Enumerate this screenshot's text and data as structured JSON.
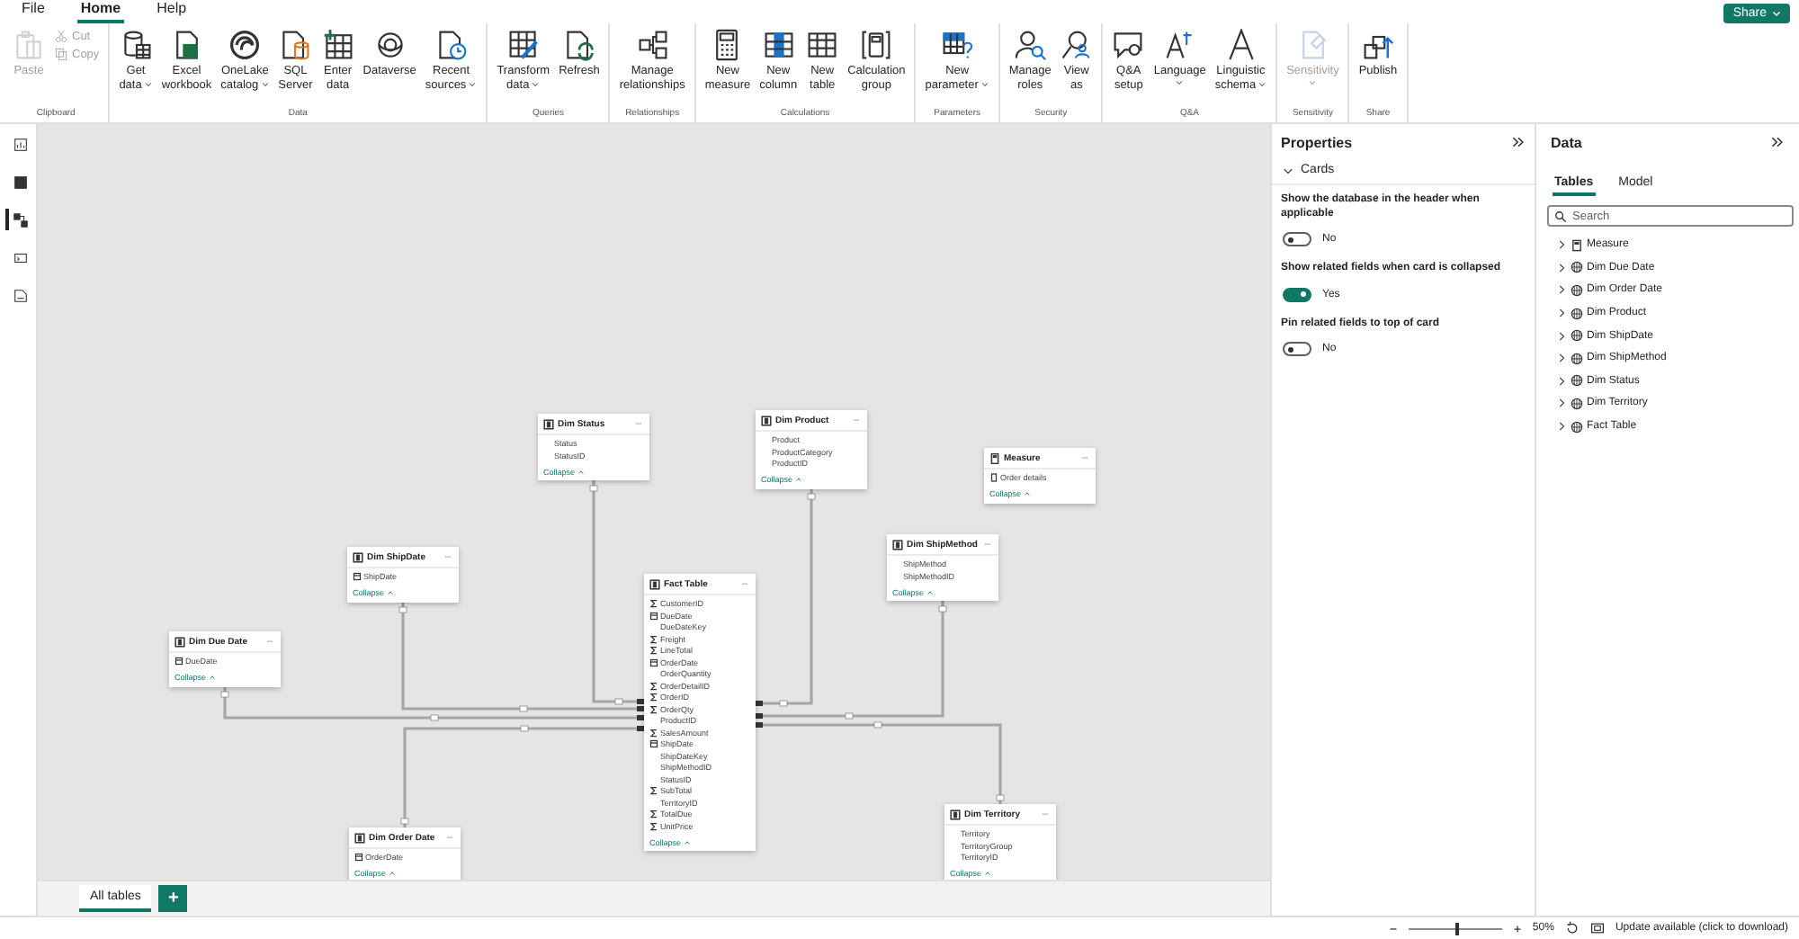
{
  "menu_tabs": [
    {
      "label": "File",
      "selected": false
    },
    {
      "label": "Home",
      "selected": true
    },
    {
      "label": "Help",
      "selected": false
    }
  ],
  "share_button": {
    "label": "Share"
  },
  "ribbon": [
    {
      "label": "Clipboard",
      "buttons": [
        {
          "kind": "large",
          "lines": [
            "Paste"
          ],
          "disabled": true,
          "dropdown": false
        },
        {
          "kind": "small",
          "lines": [
            "Cut"
          ],
          "disabled": true,
          "dropdown": false
        },
        {
          "kind": "small",
          "lines": [
            "Copy"
          ],
          "disabled": true,
          "dropdown": false
        }
      ]
    },
    {
      "label": "Data",
      "buttons": [
        {
          "kind": "large",
          "lines": [
            "Get",
            "data"
          ],
          "disabled": false,
          "dropdown": true
        },
        {
          "kind": "large",
          "lines": [
            "Excel",
            "workbook"
          ],
          "disabled": false,
          "dropdown": false
        },
        {
          "kind": "large",
          "lines": [
            "OneLake",
            "catalog"
          ],
          "disabled": false,
          "dropdown": true
        },
        {
          "kind": "large",
          "lines": [
            "SQL",
            "Server"
          ],
          "disabled": false,
          "dropdown": false
        },
        {
          "kind": "large",
          "lines": [
            "Enter",
            "data"
          ],
          "disabled": false,
          "dropdown": false
        },
        {
          "kind": "large",
          "lines": [
            "Dataverse"
          ],
          "disabled": false,
          "dropdown": false
        },
        {
          "kind": "large",
          "lines": [
            "Recent",
            "sources"
          ],
          "disabled": false,
          "dropdown": true
        }
      ]
    },
    {
      "label": "Queries",
      "buttons": [
        {
          "kind": "large",
          "lines": [
            "Transform",
            "data"
          ],
          "disabled": false,
          "dropdown": true
        },
        {
          "kind": "large",
          "lines": [
            "Refresh"
          ],
          "disabled": false,
          "dropdown": false
        }
      ]
    },
    {
      "label": "Relationships",
      "buttons": [
        {
          "kind": "large",
          "lines": [
            "Manage",
            "relationships"
          ],
          "disabled": false,
          "dropdown": false
        }
      ]
    },
    {
      "label": "Calculations",
      "buttons": [
        {
          "kind": "large",
          "lines": [
            "New",
            "measure"
          ],
          "disabled": false,
          "dropdown": false
        },
        {
          "kind": "large",
          "lines": [
            "New",
            "column"
          ],
          "disabled": false,
          "dropdown": false
        },
        {
          "kind": "large",
          "lines": [
            "New",
            "table"
          ],
          "disabled": false,
          "dropdown": false
        },
        {
          "kind": "large",
          "lines": [
            "Calculation",
            "group"
          ],
          "disabled": false,
          "dropdown": false
        }
      ]
    },
    {
      "label": "Parameters",
      "buttons": [
        {
          "kind": "large",
          "lines": [
            "New",
            "parameter"
          ],
          "disabled": false,
          "dropdown": true
        }
      ]
    },
    {
      "label": "Security",
      "buttons": [
        {
          "kind": "large",
          "lines": [
            "Manage",
            "roles"
          ],
          "disabled": false,
          "dropdown": false
        },
        {
          "kind": "large",
          "lines": [
            "View",
            "as"
          ],
          "disabled": false,
          "dropdown": false
        }
      ]
    },
    {
      "label": "Q&A",
      "buttons": [
        {
          "kind": "large",
          "lines": [
            "Q&A",
            "setup"
          ],
          "disabled": false,
          "dropdown": false
        },
        {
          "kind": "large",
          "lines": [
            "Language"
          ],
          "disabled": false,
          "dropdown": true
        },
        {
          "kind": "large",
          "lines": [
            "Linguistic",
            "schema"
          ],
          "disabled": false,
          "dropdown": true
        }
      ]
    },
    {
      "label": "Sensitivity",
      "buttons": [
        {
          "kind": "large",
          "lines": [
            "Sensitivity"
          ],
          "disabled": true,
          "dropdown": true
        }
      ]
    },
    {
      "label": "Share",
      "buttons": [
        {
          "kind": "large",
          "lines": [
            "Publish"
          ],
          "disabled": false,
          "dropdown": false
        }
      ]
    }
  ],
  "view_rail": [
    {
      "selected": false
    },
    {
      "selected": false
    },
    {
      "selected": true
    },
    {
      "selected": false
    },
    {
      "selected": false
    }
  ],
  "diagram_tables": [
    {
      "name": "Dim Status",
      "kind": "table",
      "collapse_label": "Collapse",
      "fields": [
        {
          "name": "Status",
          "kind": "text"
        },
        {
          "name": "StatusID",
          "kind": "text"
        }
      ]
    },
    {
      "name": "Dim Product",
      "kind": "table",
      "collapse_label": "Collapse",
      "fields": [
        {
          "name": "Product",
          "kind": "text"
        },
        {
          "name": "ProductCategory",
          "kind": "text"
        },
        {
          "name": "ProductID",
          "kind": "text"
        }
      ]
    },
    {
      "name": "Measure",
      "kind": "measure",
      "collapse_label": "Collapse",
      "fields": [
        {
          "name": "Order details",
          "kind": "measure"
        }
      ]
    },
    {
      "name": "Dim ShipDate",
      "kind": "table",
      "collapse_label": "Collapse",
      "fields": [
        {
          "name": "ShipDate",
          "kind": "date"
        }
      ]
    },
    {
      "name": "Dim ShipMethod",
      "kind": "table",
      "collapse_label": "Collapse",
      "fields": [
        {
          "name": "ShipMethod",
          "kind": "text"
        },
        {
          "name": "ShipMethodID",
          "kind": "text"
        }
      ]
    },
    {
      "name": "Fact Table",
      "kind": "table",
      "collapse_label": "Collapse",
      "fields": [
        {
          "name": "CustomerID",
          "kind": "numeric"
        },
        {
          "name": "DueDate",
          "kind": "date"
        },
        {
          "name": "DueDateKey",
          "kind": "text"
        },
        {
          "name": "Freight",
          "kind": "numeric"
        },
        {
          "name": "LineTotal",
          "kind": "numeric"
        },
        {
          "name": "OrderDate",
          "kind": "date"
        },
        {
          "name": "OrderQuantity",
          "kind": "text"
        },
        {
          "name": "OrderDetailID",
          "kind": "numeric"
        },
        {
          "name": "OrderID",
          "kind": "numeric"
        },
        {
          "name": "OrderQty",
          "kind": "numeric"
        },
        {
          "name": "ProductID",
          "kind": "text"
        },
        {
          "name": "SalesAmount",
          "kind": "numeric"
        },
        {
          "name": "ShipDate",
          "kind": "date"
        },
        {
          "name": "ShipDateKey",
          "kind": "text"
        },
        {
          "name": "ShipMethodID",
          "kind": "text"
        },
        {
          "name": "StatusID",
          "kind": "text"
        },
        {
          "name": "SubTotal",
          "kind": "numeric"
        },
        {
          "name": "TerritoryID",
          "kind": "text"
        },
        {
          "name": "TotalDue",
          "kind": "numeric"
        },
        {
          "name": "UnitPrice",
          "kind": "numeric"
        }
      ]
    },
    {
      "name": "Dim Due Date",
      "kind": "table",
      "collapse_label": "Collapse",
      "fields": [
        {
          "name": "DueDate",
          "kind": "date"
        }
      ]
    },
    {
      "name": "Dim Order Date",
      "kind": "table",
      "collapse_label": "Collapse",
      "fields": [
        {
          "name": "OrderDate",
          "kind": "date"
        }
      ]
    },
    {
      "name": "Dim Territory",
      "kind": "table",
      "collapse_label": "Collapse",
      "fields": [
        {
          "name": "Territory",
          "kind": "text"
        },
        {
          "name": "TerritoryGroup",
          "kind": "text"
        },
        {
          "name": "TerritoryID",
          "kind": "text"
        }
      ]
    }
  ],
  "layout_tabs": [
    {
      "label": "All tables",
      "selected": true
    }
  ],
  "add_tab_button": {
    "label": "+"
  },
  "properties": {
    "title": "Properties",
    "section": {
      "title": "Cards",
      "expanded": true
    },
    "settings": [
      {
        "label": "Show the database in the header when applicable",
        "on": false,
        "value": "No"
      },
      {
        "label": "Show related fields when card is collapsed",
        "on": true,
        "value": "Yes"
      },
      {
        "label": "Pin related fields to top of card",
        "on": false,
        "value": "No"
      }
    ]
  },
  "data_pane": {
    "title": "Data",
    "tabs": [
      {
        "label": "Tables",
        "selected": true
      },
      {
        "label": "Model",
        "selected": false
      }
    ],
    "search": {
      "placeholder": "Search"
    },
    "items": [
      {
        "name": "Measure",
        "kind": "measure",
        "expanded": false
      },
      {
        "name": "Dim Due Date",
        "kind": "table",
        "expanded": false
      },
      {
        "name": "Dim Order Date",
        "kind": "table",
        "expanded": false
      },
      {
        "name": "Dim Product",
        "kind": "table",
        "expanded": false
      },
      {
        "name": "Dim ShipDate",
        "kind": "table",
        "expanded": false
      },
      {
        "name": "Dim ShipMethod",
        "kind": "table",
        "expanded": false
      },
      {
        "name": "Dim Status",
        "kind": "table",
        "expanded": false
      },
      {
        "name": "Dim Territory",
        "kind": "table",
        "expanded": false
      },
      {
        "name": "Fact Table",
        "kind": "table",
        "expanded": false
      }
    ]
  },
  "status_bar": {
    "zoom": {
      "level": 0.5,
      "reading": "50%"
    },
    "update_notice": "Update available (click to download)"
  }
}
